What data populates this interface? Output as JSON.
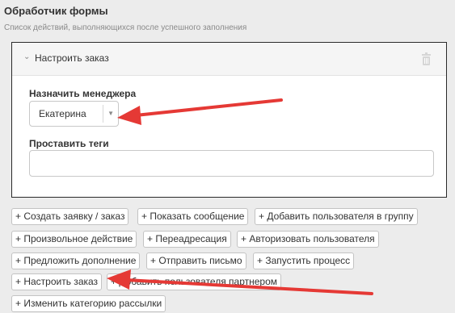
{
  "header": {
    "title": "Обработчик формы",
    "subtitle": "Список действий, выполняющихся после успешного заполнения"
  },
  "action_panel": {
    "title": "Настроить заказ",
    "chevron_icon": "chevron-down-icon",
    "trash_icon": "trash-icon",
    "manager_label": "Назначить менеджера",
    "manager_value": "Екатерина",
    "tags_label": "Проставить теги",
    "tags_value": ""
  },
  "buttons": {
    "create_order": "+ Создать заявку / заказ",
    "show_message": "+ Показать сообщение",
    "add_user_to_group": "+ Добавить пользователя в группу",
    "custom_action": "+ Произвольное действие",
    "redirect": "+ Переадресация",
    "authorize_user": "+ Авторизовать пользователя",
    "offer_addon": "+ Предложить дополнение",
    "send_email": "+ Отправить письмо",
    "start_process": "+ Запустить процесс",
    "configure_order": "+ Настроить заказ",
    "add_partner_user": "+ Добавить пользователя партнером",
    "change_mailing_category": "+ Изменить категорию рассылки"
  },
  "annotation_color": "#e53935"
}
